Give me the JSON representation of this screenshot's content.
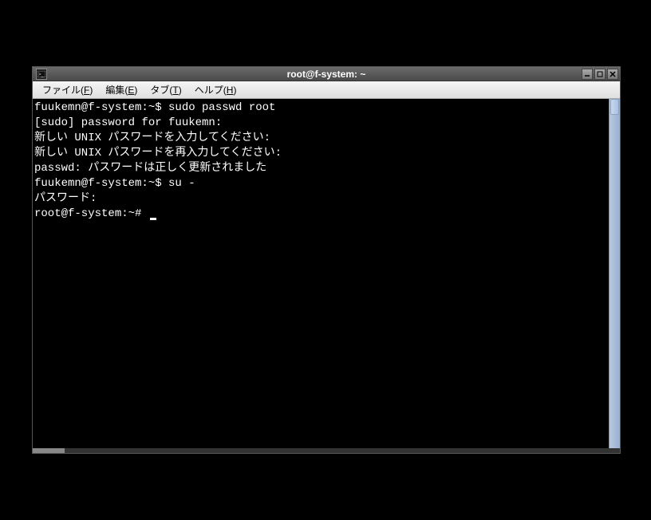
{
  "window": {
    "title": "root@f-system: ~"
  },
  "menubar": {
    "file": {
      "label": "ファイル",
      "mnemonic": "F"
    },
    "edit": {
      "label": "編集",
      "mnemonic": "E"
    },
    "tabs": {
      "label": "タブ",
      "mnemonic": "T"
    },
    "help": {
      "label": "ヘルプ",
      "mnemonic": "H"
    }
  },
  "terminal": {
    "lines": [
      "fuukemn@f-system:~$ sudo passwd root",
      "[sudo] password for fuukemn:",
      "新しい UNIX パスワードを入力してください:",
      "新しい UNIX パスワードを再入力してください:",
      "passwd: パスワードは正しく更新されました",
      "fuukemn@f-system:~$ su -",
      "パスワード:",
      "root@f-system:~# "
    ]
  }
}
